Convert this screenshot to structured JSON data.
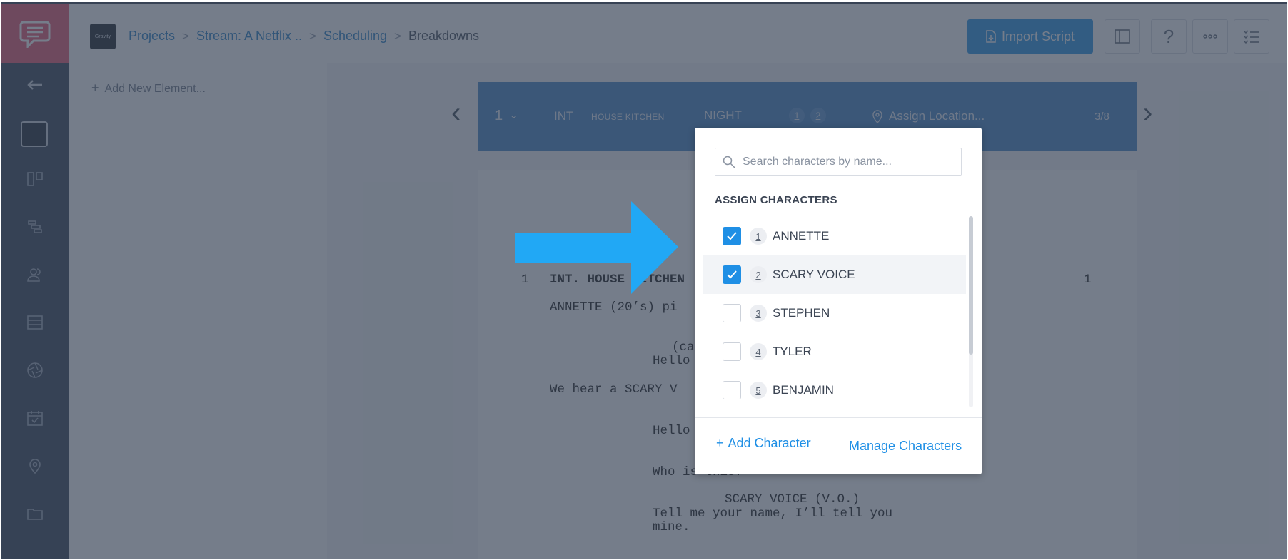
{
  "header": {
    "project_thumb_text": "Gravity",
    "breadcrumbs": [
      "Projects",
      "Stream: A Netflix ..",
      "Scheduling"
    ],
    "current_page": "Breakdowns",
    "import_button": "Import Script"
  },
  "left_panel": {
    "add_element": "Add New Element..."
  },
  "scene": {
    "number": "1",
    "int_ext": "INT",
    "set": "HOUSE KITCHEN",
    "time_of_day": "NIGHT",
    "cast_ids": [
      "1",
      "2"
    ],
    "location_placeholder": "Assign Location...",
    "page_count": "3/8"
  },
  "script": {
    "scene_number": "1",
    "heading": "INT. HOUSE KITCHEN",
    "heading_number_right": "1",
    "lines": [
      "ANNETTE (20’s) pi",
      "(ca",
      "Hello",
      "We hear a SCARY V",
      "Hello",
      "Who is this?",
      "SCARY VOICE (V.O.)",
      "Tell me your name, I’ll tell you",
      "mine."
    ]
  },
  "popup": {
    "search_placeholder": "Search characters by name...",
    "heading": "ASSIGN CHARACTERS",
    "characters": [
      {
        "id": "1",
        "name": "ANNETTE",
        "checked": true
      },
      {
        "id": "2",
        "name": "SCARY VOICE",
        "checked": true
      },
      {
        "id": "3",
        "name": "STEPHEN",
        "checked": false
      },
      {
        "id": "4",
        "name": "TYLER",
        "checked": false
      },
      {
        "id": "5",
        "name": "BENJAMIN",
        "checked": false
      }
    ],
    "add_character": "Add Character",
    "manage_characters": "Manage Characters"
  },
  "colors": {
    "accent": "#1f8fe5",
    "rail": "#2e3a4d",
    "brand": "#e8506b",
    "arrow": "#21a8f5"
  },
  "icons": {
    "rail": [
      "back-arrow-icon",
      "board-icon",
      "stripboard-icon",
      "cast-icon",
      "breakdown-list-icon",
      "aperture-icon",
      "calendar-icon",
      "location-pin-icon",
      "folder-icon"
    ],
    "header": [
      "panel-toggle-icon",
      "help-icon",
      "more-icon",
      "checklist-icon"
    ]
  }
}
